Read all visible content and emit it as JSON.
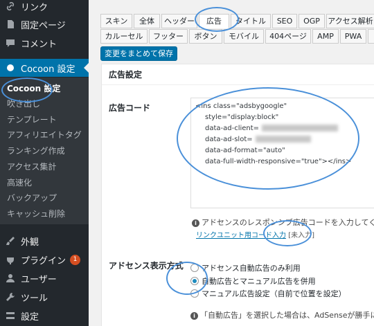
{
  "sidebar": {
    "top_items": [
      {
        "label": "リンク",
        "icon": "link-icon"
      },
      {
        "label": "固定ページ",
        "icon": "page-icon"
      },
      {
        "label": "コメント",
        "icon": "comment-icon"
      }
    ],
    "active_item": {
      "label": "Cocoon 設定",
      "icon": "circle-icon"
    },
    "submenu": [
      "Cocoon 設定",
      "吹き出し",
      "テンプレート",
      "アフィリエイトタグ",
      "ランキング作成",
      "アクセス集計",
      "高速化",
      "バックアップ",
      "キャッシュ削除"
    ],
    "bottom_items": [
      {
        "label": "外観",
        "icon": "brush-icon"
      },
      {
        "label": "プラグイン",
        "icon": "plugin-icon",
        "badge": "1"
      },
      {
        "label": "ユーザー",
        "icon": "user-icon"
      },
      {
        "label": "ツール",
        "icon": "wrench-icon"
      },
      {
        "label": "設定",
        "icon": "settings-icon"
      }
    ]
  },
  "tabs": {
    "row1": [
      "スキン",
      "全体",
      "ヘッダー",
      "広告",
      "タイトル",
      "SEO",
      "OGP",
      "アクセス解析"
    ],
    "row2": [
      "カルーセル",
      "フッター",
      "ボタン",
      "モバイル",
      "404ページ",
      "AMP",
      "PWA"
    ],
    "active": "広告"
  },
  "save_button": "変更をまとめて保存",
  "panel": {
    "title": "広告設定",
    "ad_code_label": "広告コード",
    "ad_code_lines": [
      "<ins class=\"adsbygoogle\"",
      "style=\"display:block\"",
      "data-ad-client=",
      "data-ad-slot=",
      "data-ad-format=\"auto\"",
      "data-full-width-responsive=\"true\"></ins>"
    ],
    "help_text": "アドセンスのレスポンシブ広告コードを入力してく",
    "help_link": "リンクユニット用コード入力",
    "help_status": "[未入力]",
    "display_label": "アドセンス表示方式",
    "radio_options": [
      {
        "label": "アドセンス自動広告のみ利用",
        "checked": false
      },
      {
        "label": "自動広告とマニュアル広告を併用",
        "checked": true
      },
      {
        "label": "マニュアル広告設定（自前で位置を設定）",
        "checked": false
      }
    ],
    "note": "「自動広告」を選択した場合は、AdSenseが勝手に"
  },
  "colors": {
    "sidebar_bg": "#23282d",
    "submenu_bg": "#32373c",
    "accent": "#0073aa",
    "annotation": "#4a90d9"
  }
}
